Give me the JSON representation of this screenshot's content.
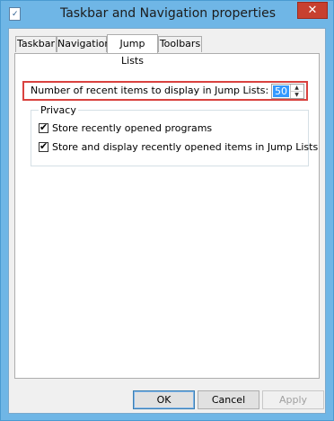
{
  "window": {
    "title": "Taskbar and Navigation properties",
    "close_label": "✕",
    "app_icon_glyph": "✓"
  },
  "tabs": [
    {
      "label": "Taskbar",
      "active": false
    },
    {
      "label": "Navigation",
      "active": false
    },
    {
      "label": "Jump Lists",
      "active": true
    },
    {
      "label": "Toolbars",
      "active": false
    }
  ],
  "jump_lists": {
    "recent_items_label": "Number of recent items to display in Jump Lists:",
    "recent_items_value": "50",
    "spin_up_glyph": "▲",
    "spin_down_glyph": "▼",
    "highlight_color": "#d9423f",
    "privacy": {
      "title": "Privacy",
      "options": [
        {
          "label": "Store recently opened programs",
          "checked": true
        },
        {
          "label": "Store and display recently opened items in Jump Lists",
          "checked": true
        }
      ],
      "check_glyph": "✔"
    }
  },
  "buttons": {
    "ok": "OK",
    "cancel": "Cancel",
    "apply": "Apply"
  },
  "colors": {
    "frame": "#6fb6e6",
    "close": "#c7402f",
    "selection": "#3399ff"
  }
}
